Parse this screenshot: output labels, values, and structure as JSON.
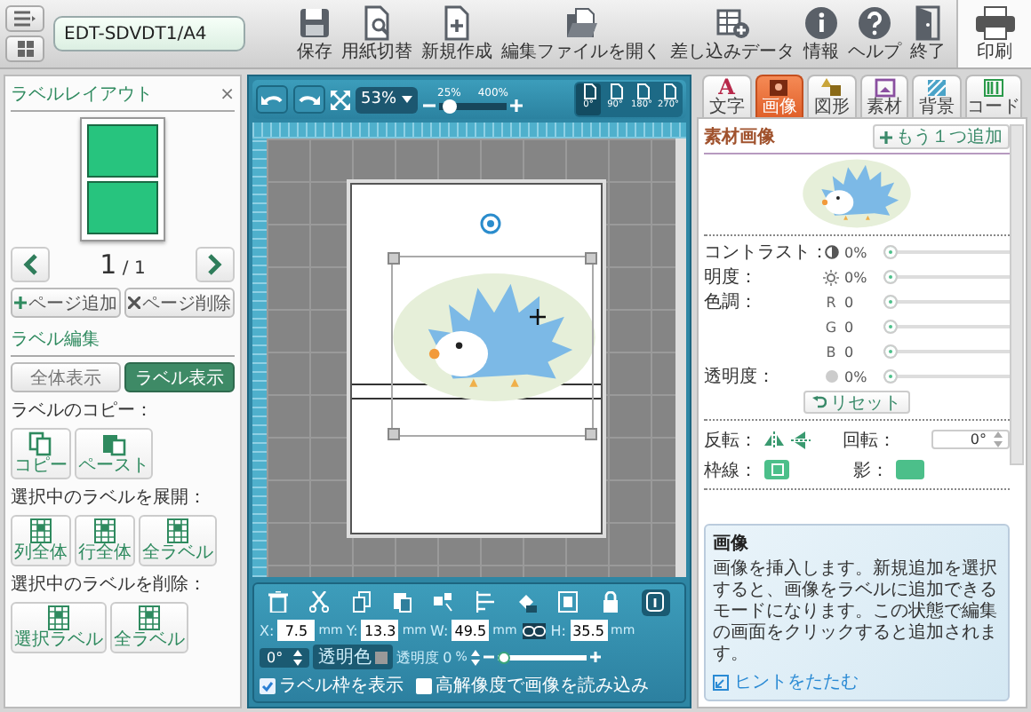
{
  "top_bar": {
    "file_name": "EDT-SDVDT1/A4",
    "tools": [
      {
        "kind": "save",
        "label": "保存"
      },
      {
        "kind": "paper",
        "label": "用紙切替"
      },
      {
        "kind": "new",
        "label": "新規作成"
      },
      {
        "kind": "open",
        "label": "編集ファイルを開く"
      },
      {
        "kind": "merge",
        "label": "差し込みデータ"
      },
      {
        "kind": "info",
        "label": "情報"
      },
      {
        "kind": "help",
        "label": "ヘルプ"
      },
      {
        "kind": "exit",
        "label": "終了"
      }
    ],
    "print": "印刷"
  },
  "left_panel": {
    "title": "ラベルレイアウト",
    "close": "×",
    "page_current": "1",
    "page_total": "/ 1",
    "page_add": "ページ追加",
    "page_delete": "ページ削除",
    "edit_title": "ラベル編集",
    "view_modes": [
      {
        "label": "全体表示",
        "selected": false
      },
      {
        "label": "ラベル表示",
        "selected": true
      }
    ],
    "copy_title": "ラベルのコピー：",
    "copy_buttons": [
      {
        "kind": "copy",
        "label": "コピー"
      },
      {
        "kind": "paste",
        "label": "ペースト"
      }
    ],
    "expand_title": "選択中のラベルを展開：",
    "expand_buttons": [
      {
        "label": "列全体"
      },
      {
        "label": "行全体"
      },
      {
        "label": "全ラベル"
      }
    ],
    "delete_title": "選択中のラベルを削除：",
    "delete_buttons": [
      {
        "label": "選択ラベル"
      },
      {
        "label": "全ラベル"
      }
    ]
  },
  "canvas_toolbar": {
    "zoom": "53%",
    "zoom_min": "25%",
    "zoom_max": "400%",
    "zoom_slider": {
      "level": 0.08
    },
    "rotations": [
      {
        "label": "0°",
        "selected": true
      },
      {
        "label": "90°",
        "selected": false
      },
      {
        "label": "180°",
        "selected": false
      },
      {
        "label": "270°",
        "selected": false
      }
    ]
  },
  "bottom_bar": {
    "fields": [
      {
        "label": "X:",
        "value": "7.5",
        "unit": "mm"
      },
      {
        "label": "Y:",
        "value": "13.3",
        "unit": "mm"
      },
      {
        "label": "W:",
        "value": "49.5",
        "unit": "mm"
      },
      {
        "label": "H:",
        "value": "35.5",
        "unit": "mm"
      }
    ],
    "angle": "0°",
    "transparent_color": "透明色",
    "show_frame": {
      "label": "ラベル枠を表示",
      "checked": true
    },
    "high_res": {
      "label": "高解像度で画像を読み込み",
      "checked": false
    },
    "opacity_label": "透明度",
    "opacity_value": "0",
    "opacity_unit": "%",
    "opacity_slider": {
      "level": 0
    }
  },
  "tabs": [
    {
      "label": "文字",
      "kind": "text",
      "glyph": "A",
      "selected": false
    },
    {
      "label": "画像",
      "kind": "image",
      "selected": true
    },
    {
      "label": "図形",
      "kind": "shape",
      "selected": false
    },
    {
      "label": "素材",
      "kind": "material",
      "selected": false
    },
    {
      "label": "背景",
      "kind": "background",
      "selected": false
    },
    {
      "label": "コード",
      "kind": "code",
      "selected": false
    }
  ],
  "panel": {
    "title": "素材画像",
    "add_button": "もう１つ追加",
    "adjustments": [
      {
        "label": "コントラスト：",
        "kind": "contrast",
        "value": "0%",
        "level": 0
      },
      {
        "label": "明度：",
        "kind": "brightness",
        "value": "0%",
        "level": 0
      },
      {
        "label": "色調：",
        "kind": "channel",
        "channel": "R",
        "value": "0",
        "level": 0
      },
      {
        "kind": "channel",
        "channel": "G",
        "value": "0",
        "level": 0
      },
      {
        "kind": "channel",
        "channel": "B",
        "value": "0",
        "level": 0
      },
      {
        "label": "透明度：",
        "kind": "opacity",
        "value": "0%",
        "level": 0
      }
    ],
    "reset": "リセット",
    "flip_label": "反転：",
    "rotate_label": "回転：",
    "rotate_value": "0°",
    "border_label": "枠線：",
    "shadow_label": "影："
  },
  "hint": {
    "title": "画像",
    "text": "画像を挿入します。新規追加を選択すると、画像をラベルに追加できるモードになります。この状態で編集の画面をクリックすると追加されます。",
    "collapse": "ヒントをたたむ"
  }
}
